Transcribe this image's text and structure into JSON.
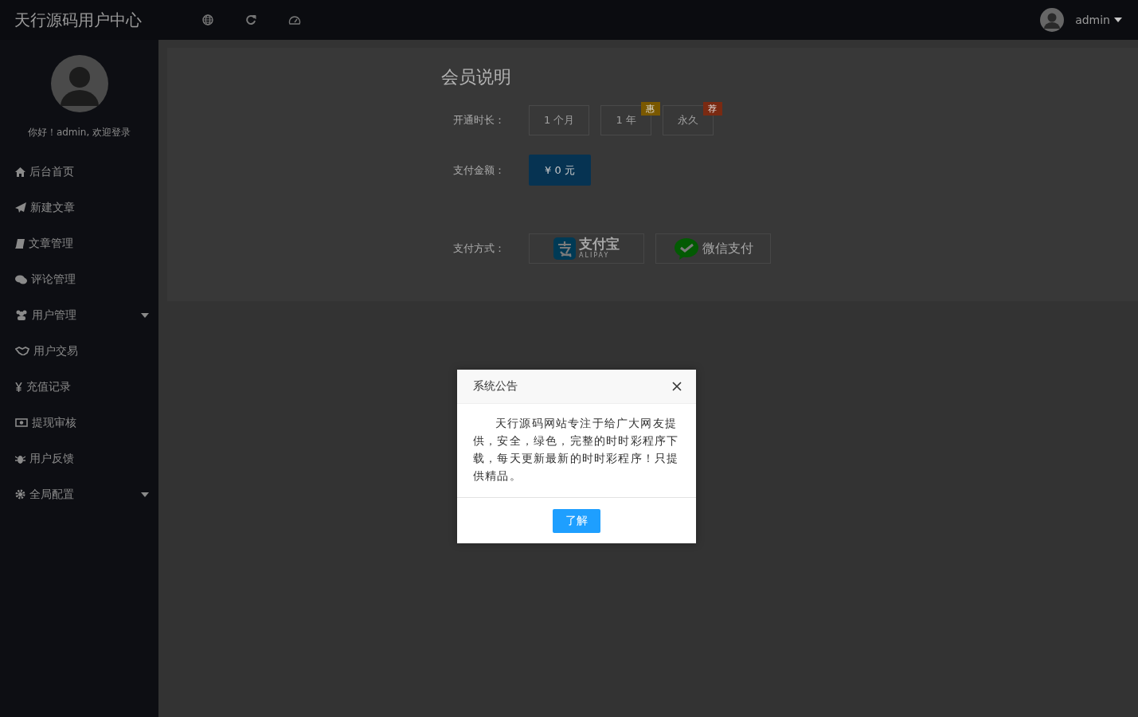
{
  "header": {
    "title": "天行源码用户中心",
    "user_name": "admin"
  },
  "sidebar": {
    "greeting": "你好！admin, 欢迎登录",
    "items": [
      {
        "label": "后台首页",
        "expandable": false
      },
      {
        "label": "新建文章",
        "expandable": false
      },
      {
        "label": "文章管理",
        "expandable": false
      },
      {
        "label": "评论管理",
        "expandable": false
      },
      {
        "label": "用户管理",
        "expandable": true
      },
      {
        "label": "用户交易",
        "expandable": false
      },
      {
        "label": "充值记录",
        "expandable": false
      },
      {
        "label": "提现审核",
        "expandable": false
      },
      {
        "label": "用户反馈",
        "expandable": false
      },
      {
        "label": "全局配置",
        "expandable": true
      }
    ]
  },
  "membership": {
    "title": "会员说明",
    "duration_label": "开通时长：",
    "durations": [
      {
        "label": "1 个月"
      },
      {
        "label": "1 年",
        "badge": {
          "text": "惠",
          "color": "#7a5800"
        }
      },
      {
        "label": "永久",
        "badge": {
          "text": "荐",
          "color": "#7a2a12"
        }
      }
    ],
    "amount_label": "支付金额：",
    "amount": "¥ 0 元",
    "payment_label": "支付方式：",
    "payment_methods": [
      {
        "kind": "alipay",
        "name": "支付宝",
        "subtitle": "ALIPAY"
      },
      {
        "kind": "wechat",
        "name": "微信支付"
      }
    ]
  },
  "dialog": {
    "title": "系统公告",
    "message": "天行源码网站专注于给广大网友提供，安全，绿色，完整的时时彩程序下载，每天更新最新的时时彩程序！只提供精品。",
    "button": "了解"
  }
}
